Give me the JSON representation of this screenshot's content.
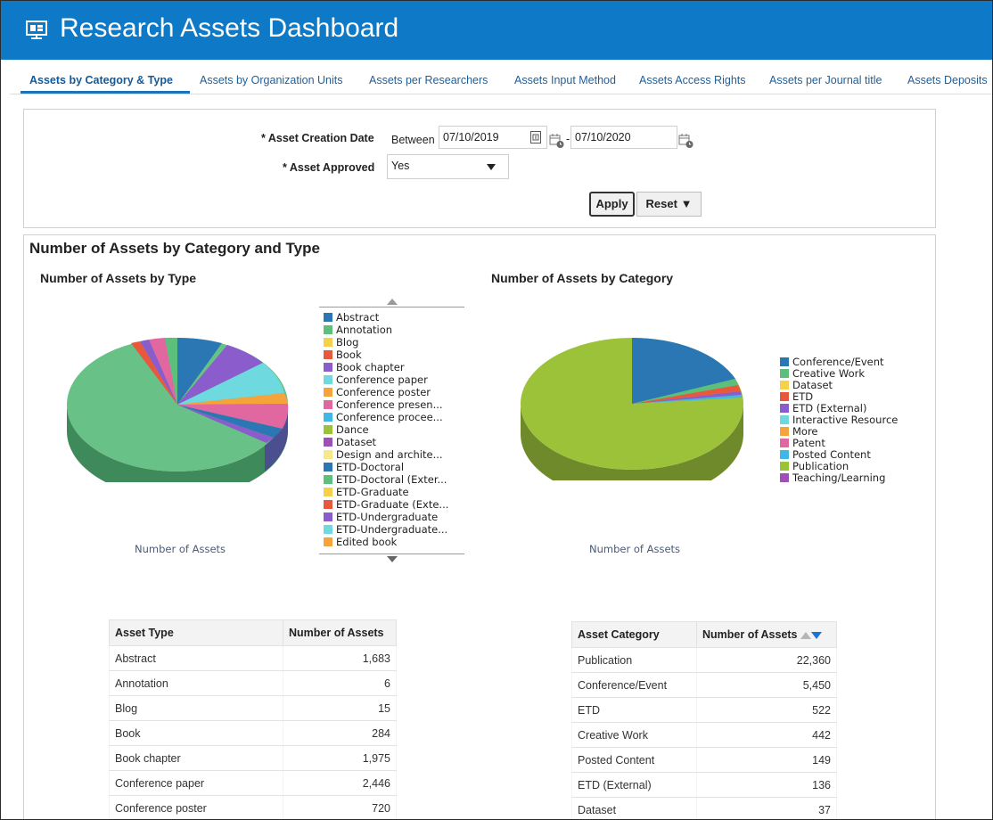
{
  "header": {
    "title": "Research Assets Dashboard",
    "logo_icon": "dashboard-icon",
    "color": "#0e79c7"
  },
  "tabs": [
    {
      "label": "Assets by Category & Type",
      "active": true
    },
    {
      "label": "Assets by Organization Units"
    },
    {
      "label": "Assets per Researchers"
    },
    {
      "label": "Assets Input Method"
    },
    {
      "label": "Assets Access Rights"
    },
    {
      "label": "Assets per Journal title"
    },
    {
      "label": "Assets Deposits"
    }
  ],
  "filters": {
    "creation_date_label": "* Asset Creation Date",
    "between_label": "Between",
    "date_from": "07/10/2019",
    "dash": "-",
    "date_to": "07/10/2020",
    "approved_label": "* Asset Approved",
    "approved_value": "Yes",
    "apply_label": "Apply",
    "reset_label": "Reset ▼"
  },
  "section_title": "Number of Assets by Category and Type",
  "type_chart": {
    "title": "Number of Assets by Type",
    "xlabel": "Number of Assets",
    "legend": [
      {
        "label": "Abstract",
        "color": "#2a77b3"
      },
      {
        "label": "Annotation",
        "color": "#5cbf7c"
      },
      {
        "label": "Blog",
        "color": "#f7d04a"
      },
      {
        "label": "Book",
        "color": "#e8583c"
      },
      {
        "label": "Book chapter",
        "color": "#8a5ccc"
      },
      {
        "label": "Conference paper",
        "color": "#6fd9e0"
      },
      {
        "label": "Conference poster",
        "color": "#f5a33a"
      },
      {
        "label": "Conference presen...",
        "color": "#e0679f"
      },
      {
        "label": "Conference procee...",
        "color": "#3fb8e8"
      },
      {
        "label": "Dance",
        "color": "#9cc23a"
      },
      {
        "label": "Dataset",
        "color": "#9f4fb8"
      },
      {
        "label": "Design and archite...",
        "color": "#f9e88a"
      },
      {
        "label": "ETD-Doctoral",
        "color": "#2a77b3"
      },
      {
        "label": "ETD-Doctoral (Exter...",
        "color": "#5cbf7c"
      },
      {
        "label": "ETD-Graduate",
        "color": "#f7d04a"
      },
      {
        "label": "ETD-Graduate (Exte...",
        "color": "#e8583c"
      },
      {
        "label": "ETD-Undergraduate",
        "color": "#8a5ccc"
      },
      {
        "label": "ETD-Undergraduate...",
        "color": "#6fd9e0"
      },
      {
        "label": "Edited book",
        "color": "#f5a33a"
      }
    ]
  },
  "category_chart": {
    "title": "Number of Assets by Category",
    "xlabel": "Number of Assets",
    "legend": [
      {
        "label": "Conference/Event",
        "color": "#2a77b3"
      },
      {
        "label": "Creative Work",
        "color": "#5cbf7c"
      },
      {
        "label": "Dataset",
        "color": "#f7d04a"
      },
      {
        "label": "ETD",
        "color": "#e8583c"
      },
      {
        "label": "ETD (External)",
        "color": "#8a5ccc"
      },
      {
        "label": "Interactive Resource",
        "color": "#6fd9e0"
      },
      {
        "label": "More",
        "color": "#f5a33a"
      },
      {
        "label": "Patent",
        "color": "#e0679f"
      },
      {
        "label": "Posted Content",
        "color": "#3fb8e8"
      },
      {
        "label": "Publication",
        "color": "#9cc23a"
      },
      {
        "label": "Teaching/Learning",
        "color": "#9f4fb8"
      }
    ]
  },
  "type_table": {
    "headers": [
      "Asset Type",
      "Number of Assets"
    ],
    "rows": [
      [
        "Abstract",
        "1,683"
      ],
      [
        "Annotation",
        "6"
      ],
      [
        "Blog",
        "15"
      ],
      [
        "Book",
        "284"
      ],
      [
        "Book chapter",
        "1,975"
      ],
      [
        "Conference paper",
        "2,446"
      ],
      [
        "Conference poster",
        "720"
      ]
    ]
  },
  "category_table": {
    "headers": [
      "Asset Category",
      "Number of Assets"
    ],
    "rows": [
      [
        "Publication",
        "22,360"
      ],
      [
        "Conference/Event",
        "5,450"
      ],
      [
        "ETD",
        "522"
      ],
      [
        "Creative Work",
        "442"
      ],
      [
        "Posted Content",
        "149"
      ],
      [
        "ETD (External)",
        "136"
      ],
      [
        "Dataset",
        "37"
      ]
    ]
  },
  "chart_data": [
    {
      "type": "pie",
      "title": "Number of Assets by Type",
      "xlabel": "Number of Assets",
      "categories": [
        "Abstract",
        "Annotation",
        "Blog",
        "Book",
        "Book chapter",
        "Conference paper",
        "Conference poster"
      ],
      "values": [
        1683,
        6,
        15,
        284,
        1975,
        2446,
        720
      ]
    },
    {
      "type": "pie",
      "title": "Number of Assets by Category",
      "xlabel": "Number of Assets",
      "categories": [
        "Publication",
        "Conference/Event",
        "ETD",
        "Creative Work",
        "Posted Content",
        "ETD (External)",
        "Dataset"
      ],
      "values": [
        22360,
        5450,
        522,
        442,
        149,
        136,
        37
      ]
    }
  ]
}
